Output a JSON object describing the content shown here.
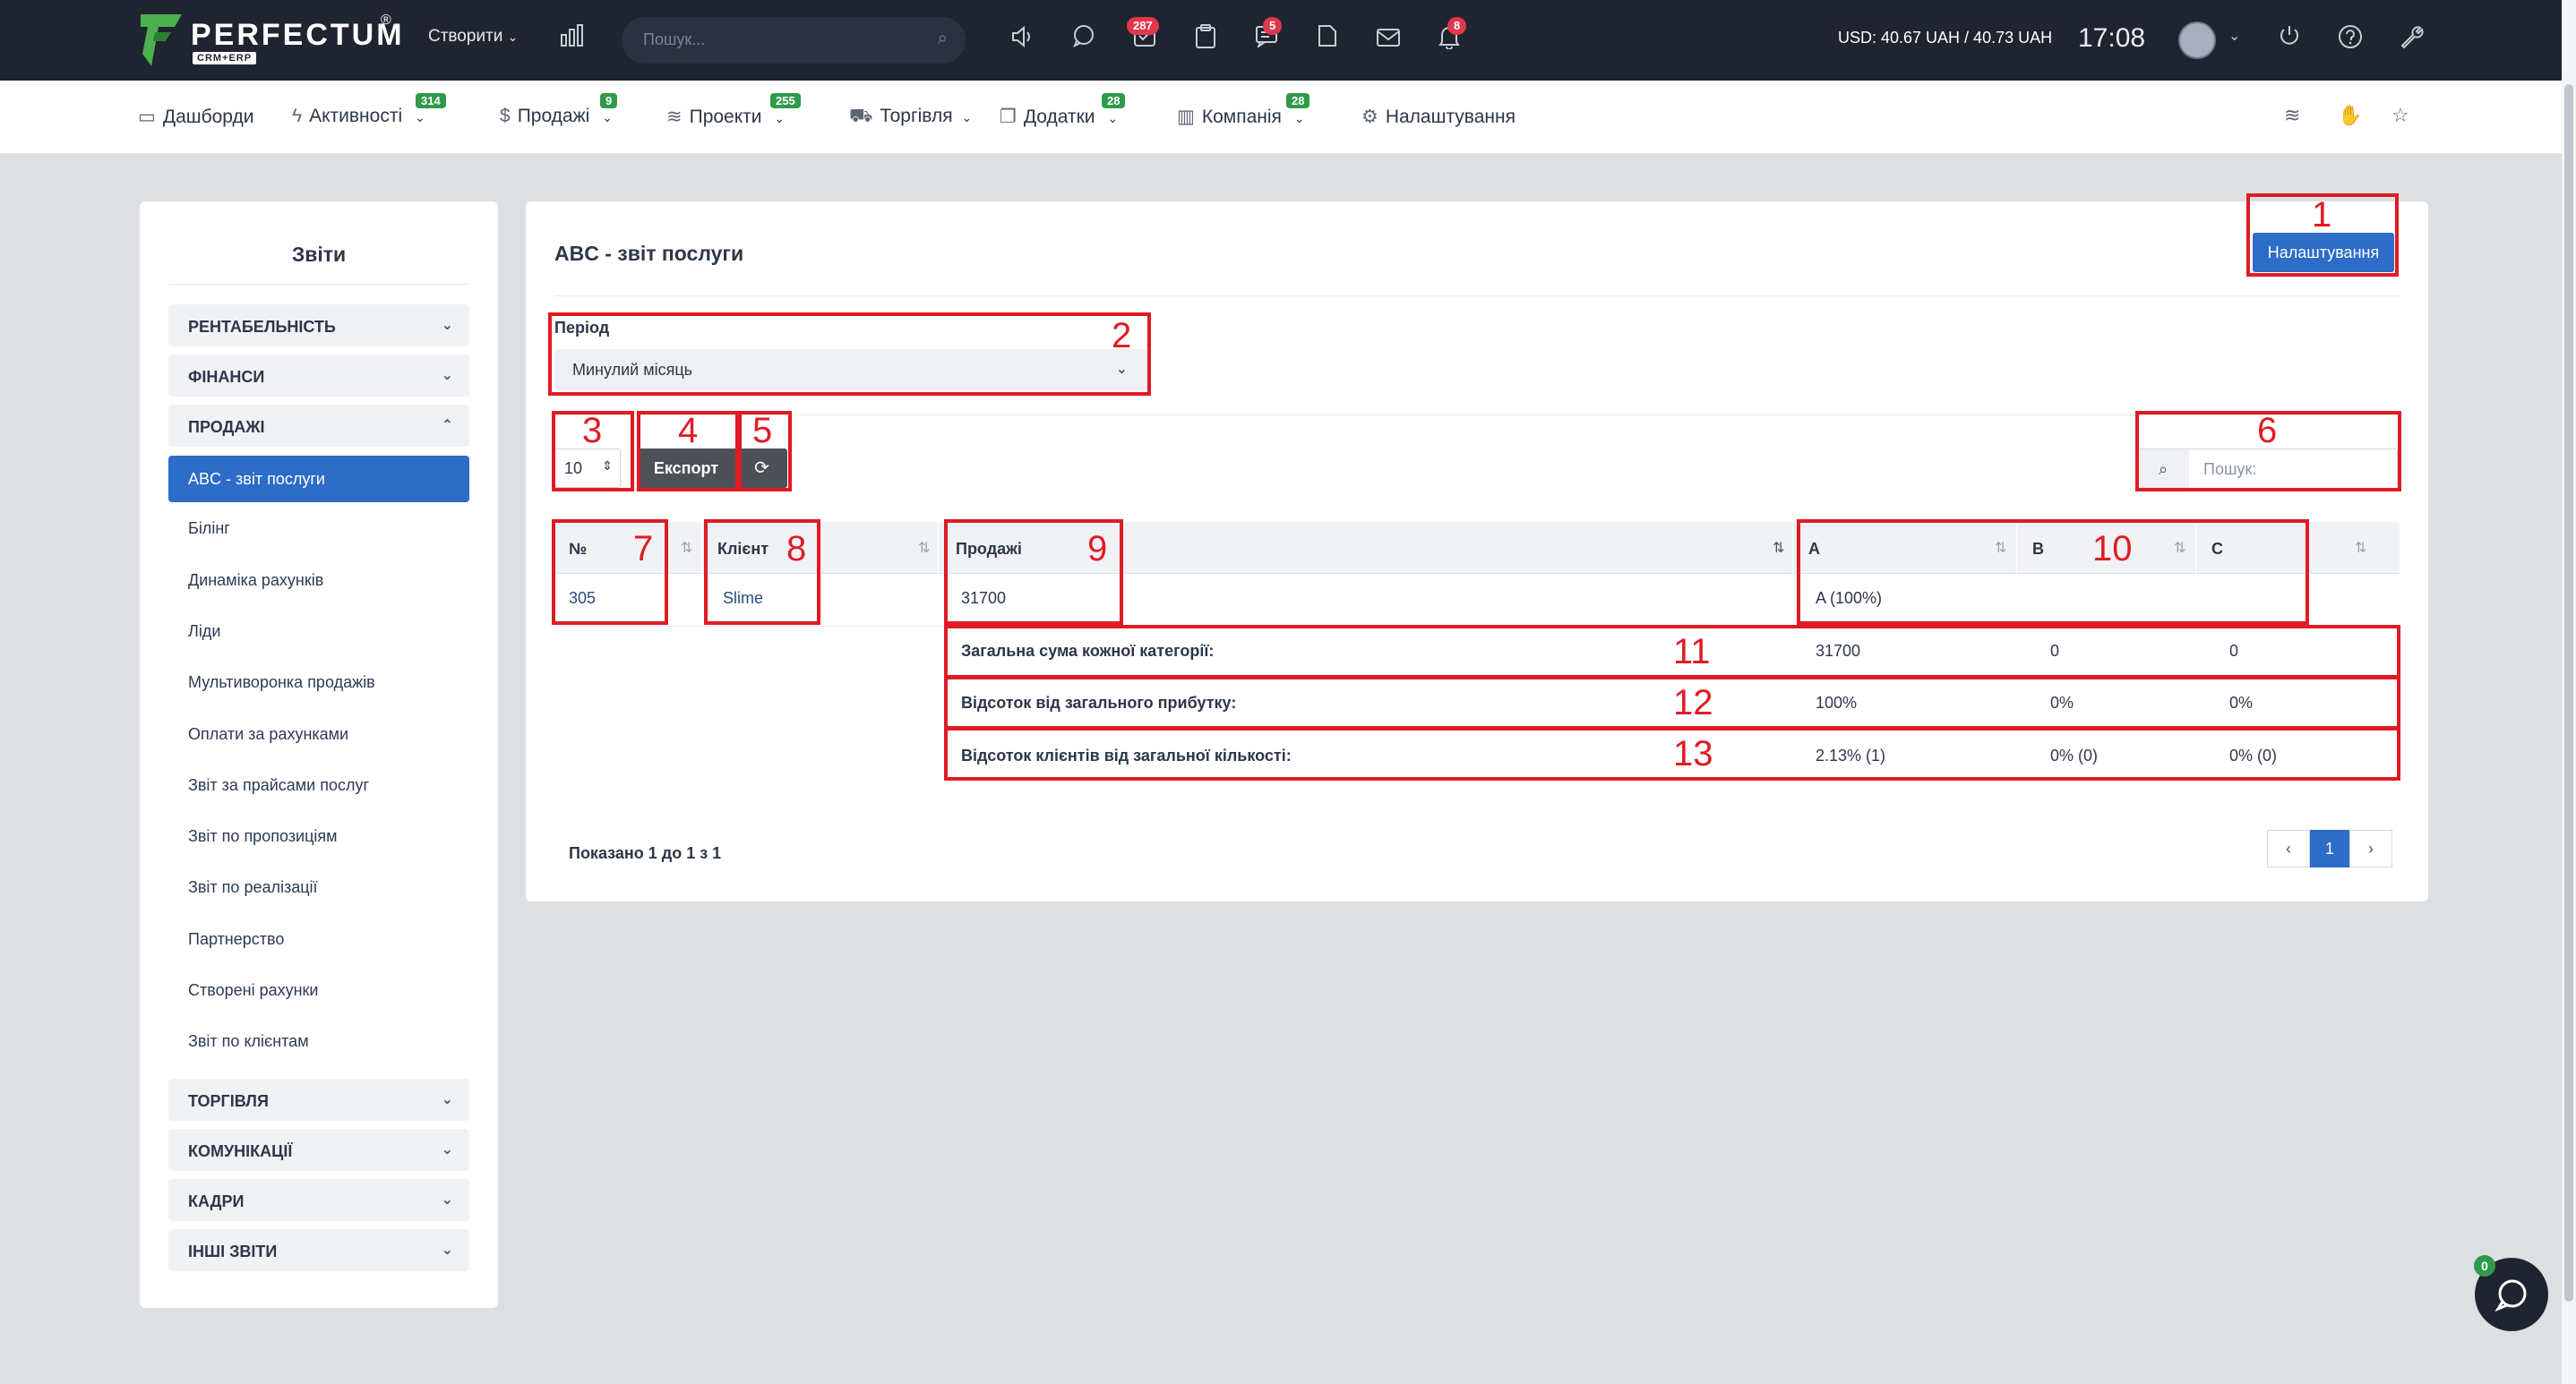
{
  "topbar": {
    "logo_text": "PERFECTUM",
    "logo_reg": "®",
    "logo_sub": "CRM+ERP",
    "create_label": "Створити",
    "search_placeholder": "Пошук...",
    "tasks_badge": "287",
    "messages_badge": "5",
    "notifications_badge": "8",
    "currency": "USD: 40.67 UAH / 40.73 UAH",
    "time": "17:08"
  },
  "nav": {
    "items": [
      {
        "label": "Дашборди",
        "badge": ""
      },
      {
        "label": "Активності",
        "badge": "314"
      },
      {
        "label": "Продажі",
        "badge": "9"
      },
      {
        "label": "Проекти",
        "badge": "255"
      },
      {
        "label": "Торгівля",
        "badge": ""
      },
      {
        "label": "Додатки",
        "badge": "28"
      },
      {
        "label": "Компанія",
        "badge": "28"
      },
      {
        "label": "Налаштування",
        "badge": ""
      }
    ]
  },
  "sidebar": {
    "title": "Звіти",
    "categories_top": [
      "РЕНТАБЕЛЬНІСТЬ",
      "ФІНАНСИ",
      "ПРОДАЖІ"
    ],
    "active_item": "ABC - звіт послуги",
    "links": [
      "Білінг",
      "Динаміка рахунків",
      "Ліди",
      "Мультиворонка продажів",
      "Оплати за рахунками",
      "Звіт за прайсами послуг",
      "Звіт по пропозиціям",
      "Звіт по реалізації",
      "Партнерство",
      "Створені рахунки",
      "Звіт по клієнтам"
    ],
    "categories_bottom": [
      "ТОРГІВЛЯ",
      "КОМУНІКАЦІЇ",
      "КАДРИ",
      "ІНШІ ЗВІТИ"
    ]
  },
  "main": {
    "title": "ABC - звіт послуги",
    "settings_button": "Налаштування",
    "period_label": "Період",
    "period_value": "Минулий місяць",
    "page_length": "10",
    "export_button": "Експорт",
    "search_placeholder": "Пошук:",
    "table": {
      "headers": [
        "№",
        "Клієнт",
        "Продажі",
        "A",
        "B",
        "C"
      ],
      "rows": [
        {
          "num": "305",
          "client": "Slime",
          "sales": "31700",
          "a": "A (100%)",
          "b": "",
          "c": ""
        }
      ],
      "footer": [
        {
          "label": "Загальна сума кожної категорії:",
          "a": "31700",
          "b": "0",
          "c": "0"
        },
        {
          "label": "Відсоток від загального прибутку:",
          "a": "100%",
          "b": "0%",
          "c": "0%"
        },
        {
          "label": "Відсоток клієнтів від загальної кількості:",
          "a": "2.13% (1)",
          "b": "0% (0)",
          "c": "0% (0)"
        }
      ]
    },
    "shown_text": "Показано 1 до 1 з 1",
    "pagination": {
      "prev": "‹",
      "current": "1",
      "next": "›"
    }
  },
  "annotations": [
    "1",
    "2",
    "3",
    "4",
    "5",
    "6",
    "7",
    "8",
    "9",
    "10",
    "11",
    "12",
    "13"
  ],
  "chat_badge": "0",
  "colors": {
    "accent": "#2d6cc7",
    "annotation": "#e01b24",
    "topbar": "#1f2430",
    "badge_red": "#e0384b",
    "badge_green": "#2f9a4a"
  }
}
